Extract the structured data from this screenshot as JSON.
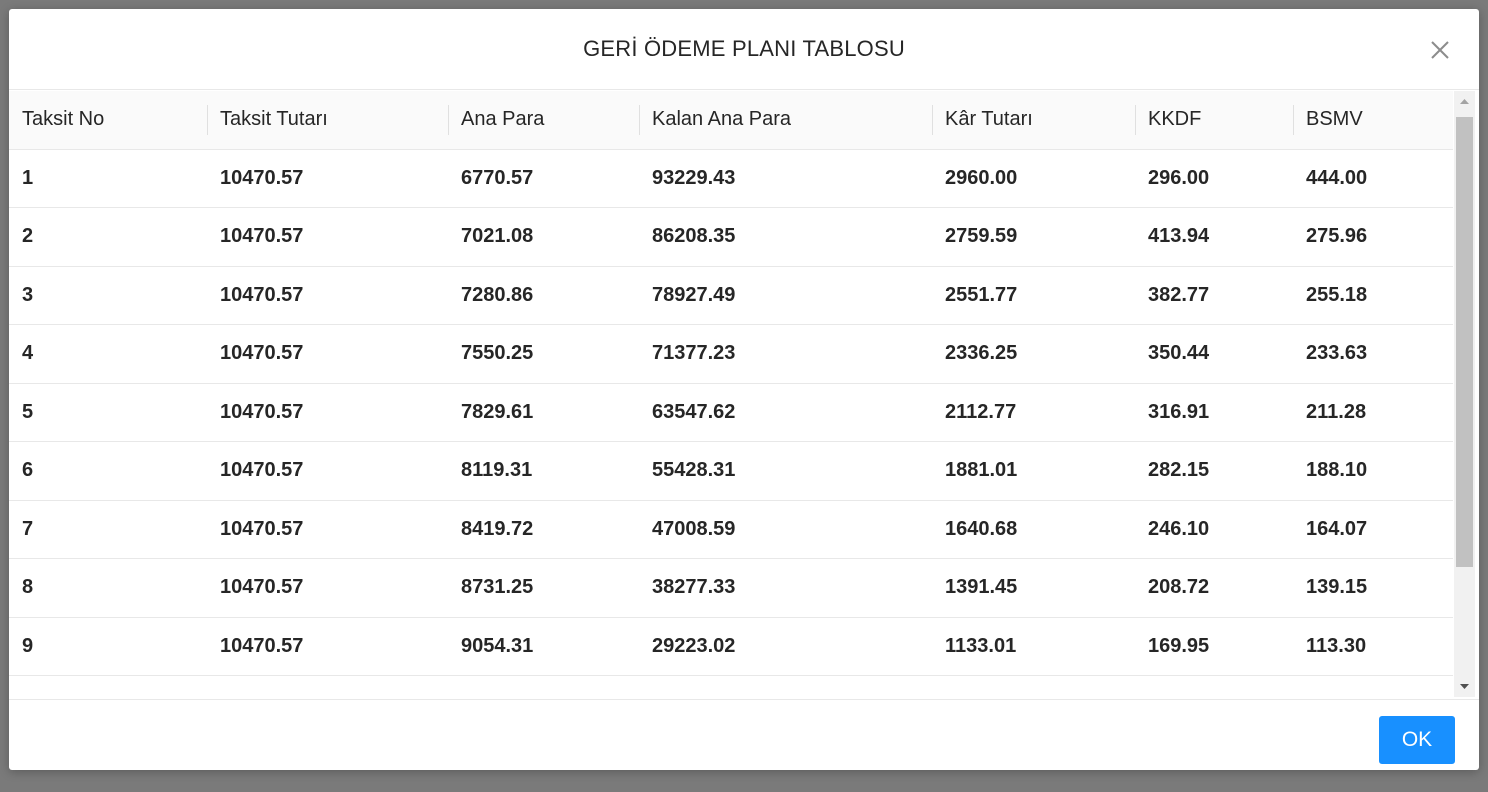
{
  "modal": {
    "title": "GERİ ÖDEME PLANI TABLOSU",
    "ok_label": "OK"
  },
  "table": {
    "headers": [
      "Taksit No",
      "Taksit Tutarı",
      "Ana Para",
      "Kalan Ana Para",
      "Kâr Tutarı",
      "KKDF",
      "BSMV"
    ],
    "rows": [
      [
        "1",
        "10470.57",
        "6770.57",
        "93229.43",
        "2960.00",
        "296.00",
        "444.00"
      ],
      [
        "2",
        "10470.57",
        "7021.08",
        "86208.35",
        "2759.59",
        "413.94",
        "275.96"
      ],
      [
        "3",
        "10470.57",
        "7280.86",
        "78927.49",
        "2551.77",
        "382.77",
        "255.18"
      ],
      [
        "4",
        "10470.57",
        "7550.25",
        "71377.23",
        "2336.25",
        "350.44",
        "233.63"
      ],
      [
        "5",
        "10470.57",
        "7829.61",
        "63547.62",
        "2112.77",
        "316.91",
        "211.28"
      ],
      [
        "6",
        "10470.57",
        "8119.31",
        "55428.31",
        "1881.01",
        "282.15",
        "188.10"
      ],
      [
        "7",
        "10470.57",
        "8419.72",
        "47008.59",
        "1640.68",
        "246.10",
        "164.07"
      ],
      [
        "8",
        "10470.57",
        "8731.25",
        "38277.33",
        "1391.45",
        "208.72",
        "139.15"
      ],
      [
        "9",
        "10470.57",
        "9054.31",
        "29223.02",
        "1133.01",
        "169.95",
        "113.30"
      ]
    ]
  },
  "colors": {
    "primary": "#1890ff",
    "header_bg": "#fafafa",
    "border": "#e8e8e8"
  },
  "icons": {
    "close": "close-icon",
    "scroll_up": "arrow-up-icon",
    "scroll_down": "arrow-down-icon"
  }
}
